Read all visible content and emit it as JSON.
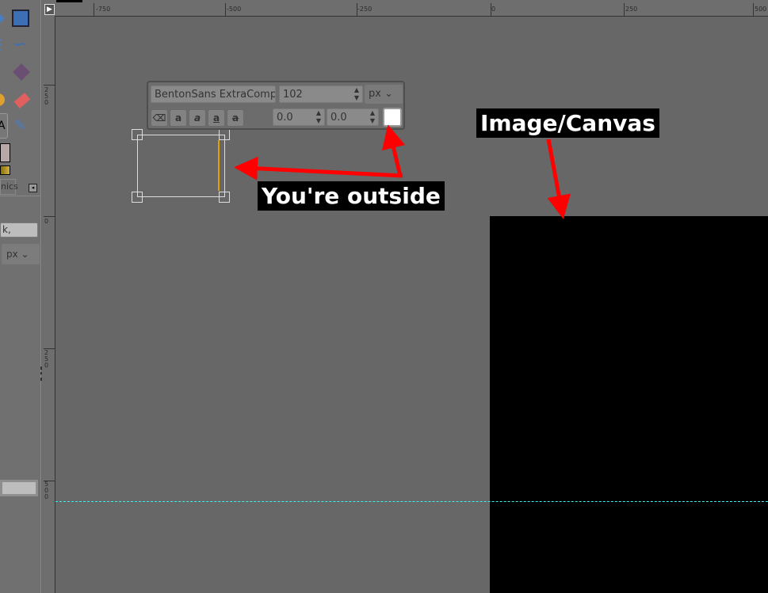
{
  "left_panel": {
    "tab_label": "nics",
    "text_field_value": "k,",
    "unit_select": "px"
  },
  "rulers": {
    "horizontal": [
      "-750",
      "-500",
      "-250",
      "0",
      "250",
      "500"
    ],
    "vertical": [
      "250",
      "0",
      "250",
      "500"
    ]
  },
  "text_toolbox": {
    "font": "BentonSans ExtraComp",
    "size": "102",
    "unit": "px",
    "letter_spacing": "0.0",
    "line_spacing": "0.0",
    "color": "#ffffff"
  },
  "annotations": {
    "canvas_label": "Image/Canvas",
    "outside_label": "You're outside",
    "arrow_color": "#ff0000"
  }
}
